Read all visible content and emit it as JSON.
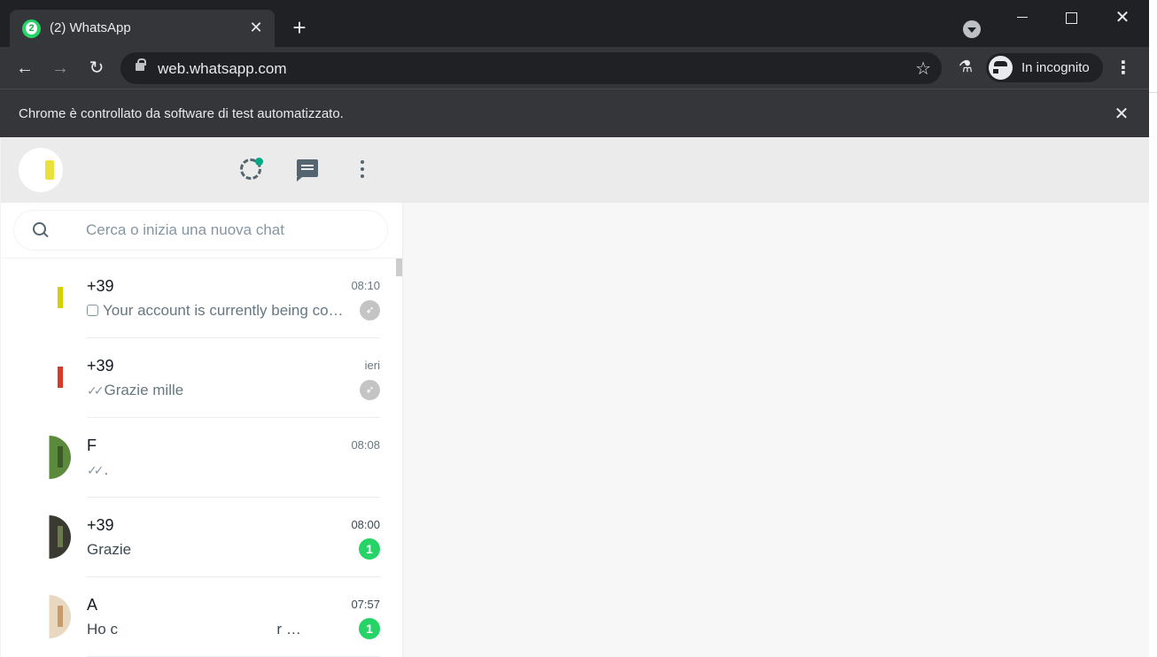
{
  "browser": {
    "tab_title": "(2) WhatsApp",
    "tab_badge": "2",
    "url": "web.whatsapp.com",
    "incognito_label": "In incognito",
    "infobar_message": "Chrome è controllato da software di test automatizzato.",
    "close_glyph": "✕",
    "newtab_glyph": "+",
    "back_glyph": "←",
    "forward_glyph": "→",
    "reload_glyph": "↻",
    "star_glyph": "☆",
    "labs_glyph": "⚗",
    "menu_glyph": "⋮"
  },
  "whatsapp": {
    "search_placeholder": "Cerca o inizia una nuova chat",
    "chats": [
      {
        "name": "+39",
        "time": "08:10",
        "preview": "Your account is currently being co…",
        "status": "pending",
        "pinned": true,
        "pic_color": "#ffffff",
        "pic_accent": "#d6d000"
      },
      {
        "name": "+39",
        "time": "ieri",
        "preview": "Grazie mille",
        "status": "read",
        "pinned": true,
        "pic_color": "#ffffff",
        "pic_accent": "#d63a2a"
      },
      {
        "name": "F",
        "time": "08:08",
        "preview": ".",
        "status": "read",
        "pinned": false,
        "pic_color": "#5b8a3c",
        "pic_accent": "#3a5a28"
      },
      {
        "name": "+39",
        "time": "08:00",
        "preview": "Grazie",
        "status": "unread",
        "unread_count": "1",
        "pic_color": "#3a3a32",
        "pic_accent": "#6b7a4a"
      },
      {
        "name": "A",
        "time": "07:57",
        "preview": "Ho c                                      r …",
        "status": "unread",
        "unread_count": "1",
        "pic_color": "#e9d8c0",
        "pic_accent": "#c79a6a"
      }
    ]
  }
}
